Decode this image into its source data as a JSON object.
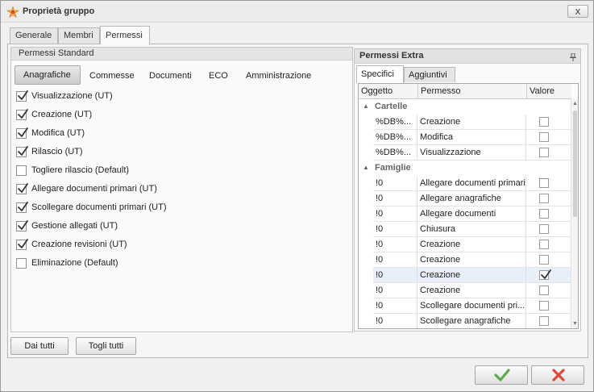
{
  "window": {
    "title": "Proprietà gruppo",
    "close_label": "x"
  },
  "tabs": [
    {
      "label": "Generale"
    },
    {
      "label": "Membri"
    },
    {
      "label": "Permessi"
    }
  ],
  "left_group": {
    "title": "Permessi Standard",
    "subtabs": [
      {
        "label": "Anagrafiche"
      },
      {
        "label": "Commesse"
      },
      {
        "label": "Documenti"
      },
      {
        "label": "ECO"
      },
      {
        "label": "Amministrazione"
      }
    ],
    "items": [
      {
        "label": "Visualizzazione (UT)",
        "checked": true
      },
      {
        "label": "Creazione (UT)",
        "checked": true
      },
      {
        "label": "Modifica (UT)",
        "checked": true
      },
      {
        "label": "Rilascio (UT)",
        "checked": true
      },
      {
        "label": "Togliere rilascio (Default)",
        "checked": false
      },
      {
        "label": "Allegare documenti primari (UT)",
        "checked": true
      },
      {
        "label": "Scollegare documenti primari (UT)",
        "checked": true
      },
      {
        "label": "Gestione allegati (UT)",
        "checked": true
      },
      {
        "label": "Creazione revisioni (UT)",
        "checked": true
      },
      {
        "label": "Eliminazione (Default)",
        "checked": false
      }
    ],
    "buttons": {
      "give_all": "Dai tutti",
      "take_all": "Togli tutti"
    }
  },
  "right_group": {
    "title": "Permessi Extra",
    "tabs": [
      {
        "label": "Specifici"
      },
      {
        "label": "Aggiuntivi"
      }
    ],
    "columns": [
      "Oggetto",
      "Permesso",
      "Valore"
    ],
    "groups": [
      {
        "name": "Cartelle",
        "rows": [
          {
            "oggetto": "%DB%...",
            "permesso": "Creazione",
            "valore": false
          },
          {
            "oggetto": "%DB%...",
            "permesso": "Modifica",
            "valore": false
          },
          {
            "oggetto": "%DB%...",
            "permesso": "Visualizzazione",
            "valore": false
          }
        ]
      },
      {
        "name": "Famiglie",
        "rows": [
          {
            "oggetto": "!0",
            "permesso": "Allegare documenti primari",
            "valore": false
          },
          {
            "oggetto": "!0",
            "permesso": "Allegare anagrafiche",
            "valore": false
          },
          {
            "oggetto": "!0",
            "permesso": "Allegare documenti",
            "valore": false
          },
          {
            "oggetto": "!0",
            "permesso": "Chiusura",
            "valore": false
          },
          {
            "oggetto": "!0",
            "permesso": "Creazione",
            "valore": false
          },
          {
            "oggetto": "!0",
            "permesso": "Creazione",
            "valore": false
          },
          {
            "oggetto": "!0",
            "permesso": "Creazione",
            "valore": true,
            "selected": true
          },
          {
            "oggetto": "!0",
            "permesso": "Creazione",
            "valore": false
          },
          {
            "oggetto": "!0",
            "permesso": "Scollegare documenti pri...",
            "valore": false
          },
          {
            "oggetto": "!0",
            "permesso": "Scollegare anagrafiche",
            "valore": false
          }
        ]
      }
    ]
  },
  "colors": {
    "ok": "#5faa4a",
    "cancel": "#e0463a",
    "selection": "#e9eefb"
  },
  "icons": {
    "ok": "check-icon",
    "cancel": "cross-icon",
    "title": "group-icon",
    "pin": "pin-icon"
  }
}
